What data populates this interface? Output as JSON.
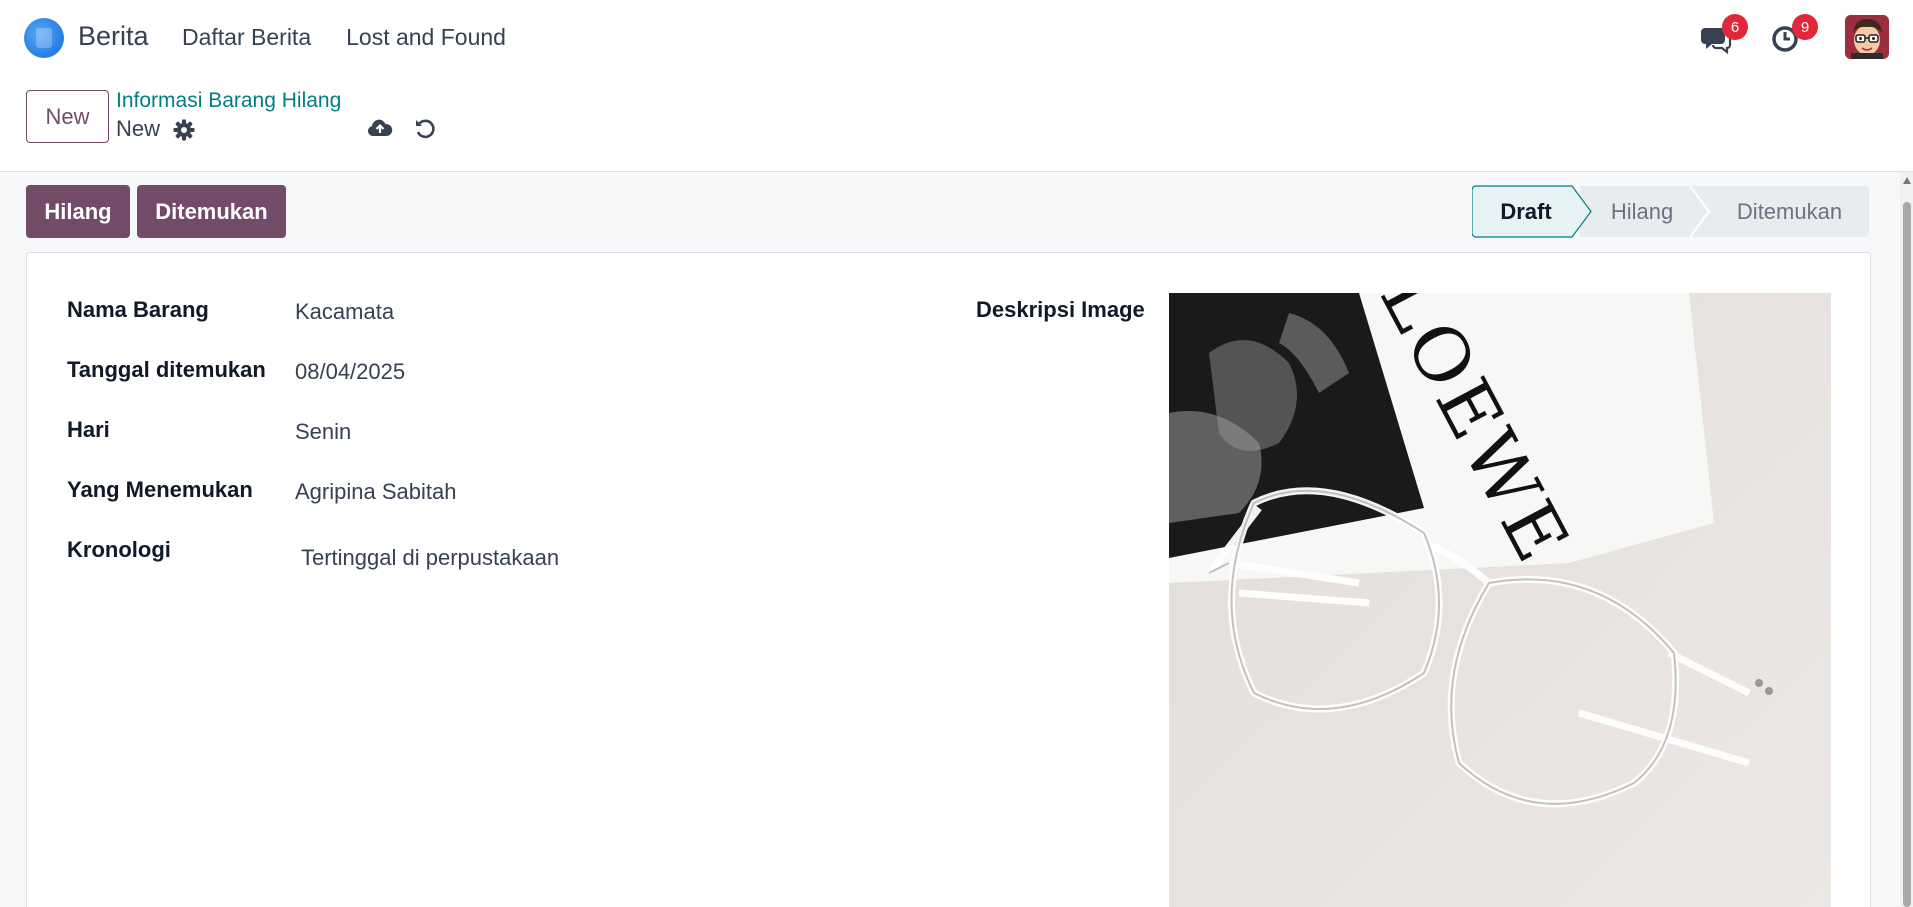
{
  "navbar": {
    "app_name": "Berita",
    "menu": [
      "Daftar Berita",
      "Lost and Found"
    ],
    "messages_count": "6",
    "activities_count": "9"
  },
  "control_panel": {
    "new_button": "New",
    "breadcrumb": "Informasi Barang Hilang",
    "record_name": "New"
  },
  "statusbar": {
    "buttons": [
      "Hilang",
      "Ditemukan"
    ],
    "stages": [
      "Draft",
      "Hilang",
      "Ditemukan"
    ],
    "active_stage": "Draft"
  },
  "form": {
    "fields": [
      {
        "label": "Nama Barang",
        "value": "Kacamata"
      },
      {
        "label": "Tanggal ditemukan",
        "value": "08/04/2025"
      },
      {
        "label": "Hari",
        "value": "Senin"
      },
      {
        "label": "Yang Menemukan",
        "value": "Agripina Sabitah"
      },
      {
        "label": "Kronologi",
        "value": "Tertinggal di perpustakaan"
      }
    ],
    "image_label": "Deskripsi Image",
    "image_brand_text": "LOEWE"
  },
  "colors": {
    "primary": "#714b67",
    "link": "#017e84",
    "badge": "#e0283a"
  }
}
